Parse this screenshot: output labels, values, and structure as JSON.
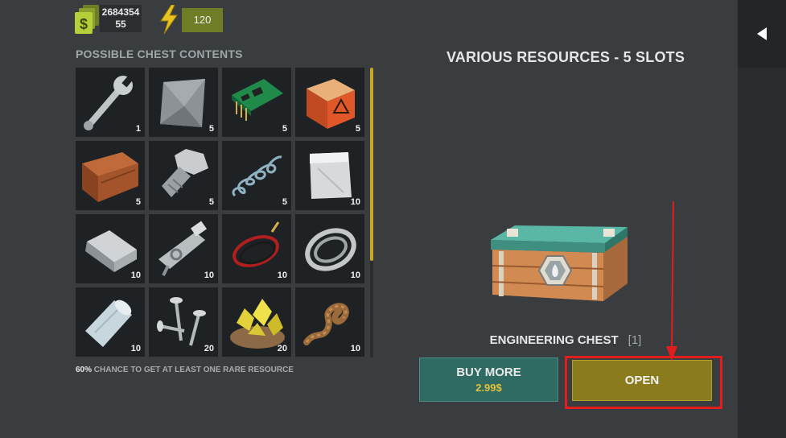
{
  "currency": {
    "cash_amount": "2684354",
    "cash_sub": "55",
    "energy": "120",
    "cash_icon": "cash-stack-icon",
    "energy_icon": "lightning-bolt-icon"
  },
  "contents": {
    "title": "POSSIBLE CHEST CONTENTS",
    "items": [
      {
        "icon": "wrench-icon",
        "qty": "1"
      },
      {
        "icon": "metal-sheet-icon",
        "qty": "5"
      },
      {
        "icon": "circuit-board-icon",
        "qty": "5"
      },
      {
        "icon": "explosive-block-icon",
        "qty": "5"
      },
      {
        "icon": "wood-plank-icon",
        "qty": "5"
      },
      {
        "icon": "bolt-screw-icon",
        "qty": "5"
      },
      {
        "icon": "spring-icon",
        "qty": "5"
      },
      {
        "icon": "metal-foil-icon",
        "qty": "10"
      },
      {
        "icon": "metal-ingot-icon",
        "qty": "10"
      },
      {
        "icon": "gun-parts-icon",
        "qty": "10"
      },
      {
        "icon": "wires-icon",
        "qty": "10"
      },
      {
        "icon": "wire-coil-icon",
        "qty": "10"
      },
      {
        "icon": "tube-icon",
        "qty": "10"
      },
      {
        "icon": "nails-icon",
        "qty": "20"
      },
      {
        "icon": "gold-ore-icon",
        "qty": "20"
      },
      {
        "icon": "rope-icon",
        "qty": "10"
      }
    ],
    "chance_pct": "60%",
    "chance_text": "CHANCE TO GET AT LEAST ONE RARE RESOURCE"
  },
  "chest": {
    "slots_title": "VARIOUS RESOURCES - 5 SLOTS",
    "name": "ENGINEERING CHEST",
    "count": "[1]"
  },
  "buttons": {
    "buy_label": "BUY MORE",
    "buy_price": "2.99$",
    "open_label": "OPEN"
  },
  "colors": {
    "background": "#3a3d3f",
    "buy_button": "#2f6b62",
    "open_button": "#8a7c1d",
    "price": "#e2c23a",
    "highlight": "#e21d1d"
  }
}
